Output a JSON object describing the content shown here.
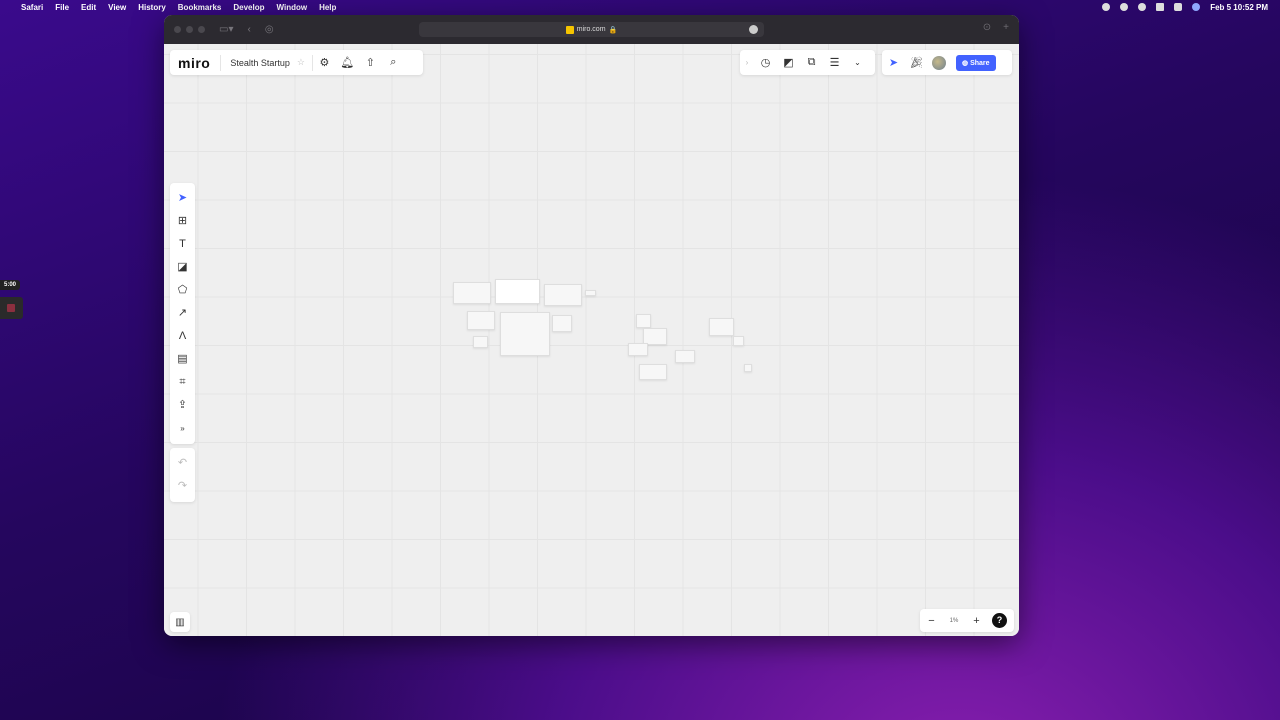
{
  "menubar": {
    "app": "Safari",
    "items": [
      "File",
      "Edit",
      "View",
      "History",
      "Bookmarks",
      "Develop",
      "Window",
      "Help"
    ],
    "datetime": "Feb 5  10:52 PM"
  },
  "recorder": {
    "timer": "5:00"
  },
  "browser": {
    "url": "miro.com"
  },
  "miro": {
    "logo": "miro",
    "board_name": "Stealth Startup",
    "share_label": "Share",
    "zoom_level": "1%",
    "help_label": "?",
    "accent": "#4262ff"
  },
  "left_tools": [
    "select",
    "templates",
    "text",
    "sticky-note",
    "shapes",
    "connection-line",
    "pen",
    "comment",
    "frame",
    "upload",
    "more"
  ]
}
